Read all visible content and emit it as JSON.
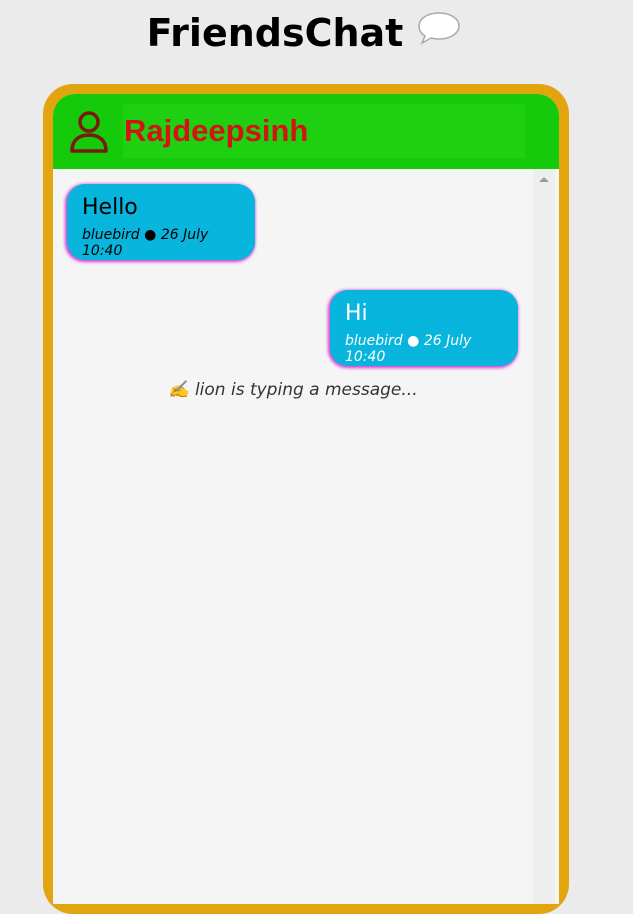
{
  "app": {
    "title": "FriendsChat",
    "title_icon": "speech-bubble-icon"
  },
  "chat": {
    "contact_name": "Rajdeepsinh",
    "contact_icon": "user-icon",
    "messages": [
      {
        "text": "Hello",
        "sender": "bluebird",
        "separator": "●",
        "time": "26 July 10:40",
        "direction": "incoming"
      },
      {
        "text": "Hi",
        "sender": "bluebird",
        "separator": "●",
        "time": "26 July 10:40",
        "direction": "outgoing"
      }
    ],
    "typing_indicator": "✍️ lion is typing a message..."
  },
  "colors": {
    "page_bg": "#ebebeb",
    "frame": "#e2a40f",
    "header": "#15c90b",
    "name_text": "#d41414",
    "bubble": "#08b5dd",
    "bubble_glow": "#d53bd6"
  }
}
